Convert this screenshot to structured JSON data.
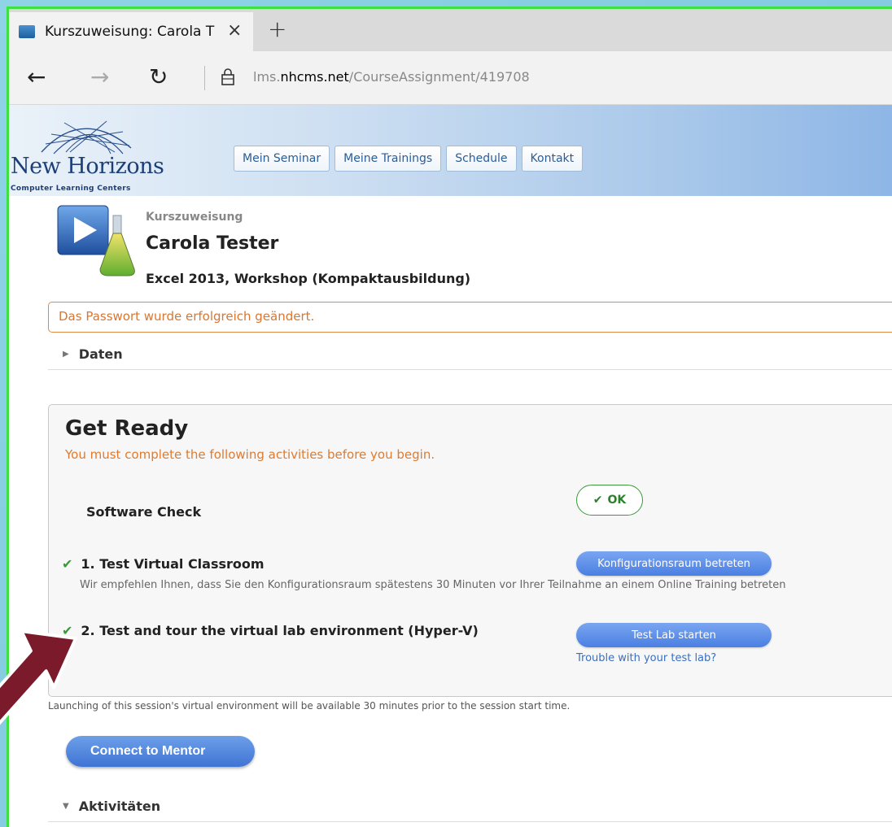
{
  "browser": {
    "tab_title": "Kurszuweisung: Carola T",
    "tab_close": "×",
    "new_tab": "+",
    "url_prefix": "lms.",
    "url_host": "nhcms.net",
    "url_path": "/CourseAssignment/419708"
  },
  "header": {
    "logo_text": "New Horizons",
    "logo_sub": "Computer Learning Centers",
    "nav": [
      "Mein Seminar",
      "Meine Trainings",
      "Schedule",
      "Kontakt"
    ]
  },
  "course": {
    "label": "Kurszuweisung",
    "name": "Carola Tester",
    "title": "Excel 2013, Workshop (Kompaktausbildung)"
  },
  "alert": "Das Passwort wurde erfolgreich geändert.",
  "sections": {
    "daten": "Daten",
    "aktivitaeten": "Aktivitäten"
  },
  "get_ready": {
    "title": "Get Ready",
    "subtitle": "You must complete the following activities before you begin.",
    "software_check": "Software Check",
    "ok": "OK",
    "item1": "1. Test Virtual Classroom",
    "item1_button": "Konfigurationsraum betreten",
    "item1_hint": "Wir empfehlen Ihnen, dass Sie den Konfigurationsraum spätestens 30 Minuten vor Ihrer Teilnahme an einem Online Training betreten",
    "item2": "2. Test and tour the virtual lab environment (Hyper-V)",
    "item2_button": "Test Lab starten",
    "item2_link": "Trouble with your test lab?"
  },
  "launch_note": "Launching of this session's virtual environment will be available 30 minutes prior to the session start time.",
  "mentor_button": "Connect to Mentor",
  "colors": {
    "frame_border": "#3ee23e",
    "accent_blue": "#4a7fe3",
    "warning_orange": "#e07a2e",
    "success_green": "#3a9a3a",
    "arrow": "#7a1a2a"
  }
}
